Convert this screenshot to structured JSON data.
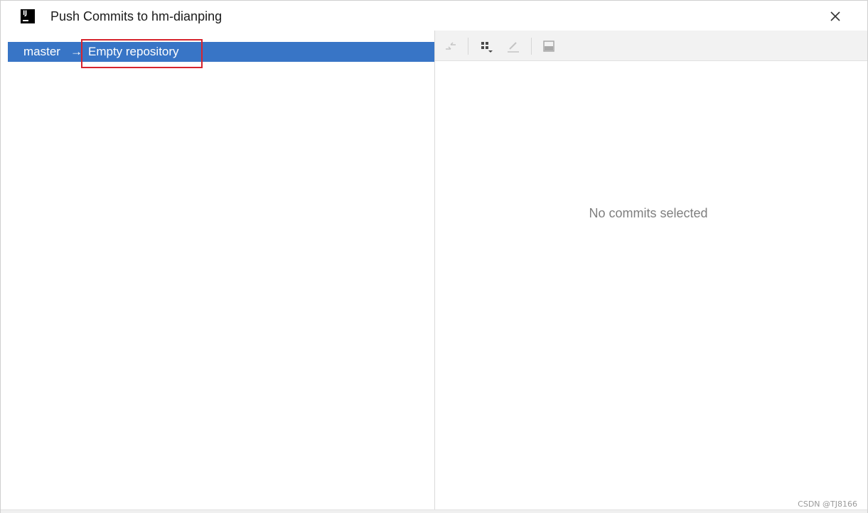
{
  "window": {
    "title": "Push Commits to hm-dianping",
    "app_icon": "intellij-logo-icon",
    "app_icon_text": "IJ",
    "close_icon": "close-icon"
  },
  "push_tree": {
    "selected_row": {
      "local_branch": "master",
      "arrow": "→",
      "remote_target": "Empty repository"
    },
    "selection_color": "#3875c6",
    "highlight_box_color": "#d6242e"
  },
  "details_toolbar": {
    "icons": [
      "collapse-icon",
      "group-by-icon",
      "edit-icon",
      "show-details-icon"
    ]
  },
  "details_panel": {
    "empty_text": "No commits selected"
  },
  "watermark": "CSDN @TJ8166"
}
